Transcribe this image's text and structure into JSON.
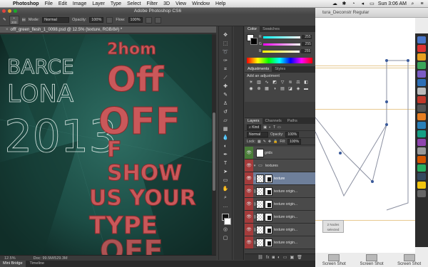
{
  "menubar": {
    "apple": "",
    "items": [
      "Photoshop",
      "File",
      "Edit",
      "Image",
      "Layer",
      "Type",
      "Select",
      "Filter",
      "3D",
      "View",
      "Window",
      "Help"
    ],
    "clock": "Sun 3:06 AM"
  },
  "background_app": {
    "title": "tura_Deconstr Regular",
    "tooltip_line1": "2 Nodes",
    "tooltip_line2": "selected",
    "screenshots": [
      "Screen Shot",
      "Screen Shot",
      "Screen Shot"
    ]
  },
  "photoshop": {
    "window_title": "Adobe Photoshop CS6",
    "options": {
      "brush_size": "200",
      "mode_label": "Mode:",
      "mode_value": "Normal",
      "opacity_label": "Opacity:",
      "opacity_value": "100%",
      "flow_label": "Flow:",
      "flow_value": "100%"
    },
    "document_tab": "offf_green_flesh_1_0098.psd @ 12.5% (texture, RGB/8#) *",
    "art_text": {
      "barce": "BARCE",
      "lona": "LONA",
      "year": "2013",
      "line1": "2hom",
      "line2": "Off",
      "line3": "OFF",
      "line4": "F",
      "line5": "SHOW",
      "line6": "US YOUR",
      "line7": "TYPE",
      "line8": "OFF"
    },
    "status": {
      "zoom": "12.5%",
      "doc": "Doc: 99.5M/529.3M"
    },
    "bottom_tabs": [
      "Mini Bridge",
      "Timeline"
    ],
    "color_panel": {
      "tabs": [
        "Color",
        "Swatches"
      ],
      "values": [
        "255",
        "255",
        "255"
      ]
    },
    "adjustments": {
      "tabs": [
        "Adjustments",
        "Styles"
      ],
      "heading": "Add an adjustment"
    },
    "layers": {
      "tabs": [
        "Layers",
        "Channels",
        "Paths"
      ],
      "kind_label": "Kind",
      "blend_mode": "Normal",
      "opacity_label": "Opacity:",
      "opacity_value": "100%",
      "lock_label": "Lock:",
      "fill_label": "Fill:",
      "fill_value": "100%",
      "items": [
        {
          "name": "grids",
          "type": "layer"
        },
        {
          "name": "textures",
          "type": "folder"
        },
        {
          "name": "texture",
          "type": "layer"
        },
        {
          "name": "texture origin...",
          "type": "layer"
        },
        {
          "name": "texture origin...",
          "type": "layer"
        },
        {
          "name": "texture origin...",
          "type": "layer"
        },
        {
          "name": "texture origin...",
          "type": "layer"
        },
        {
          "name": "texture origin...",
          "type": "layer"
        }
      ]
    }
  }
}
